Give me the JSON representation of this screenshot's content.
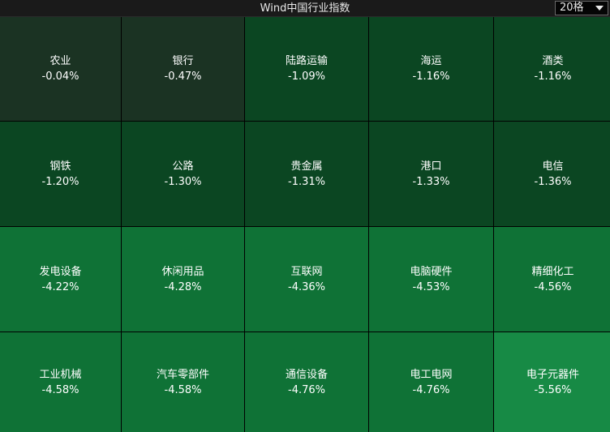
{
  "header": {
    "title": "Wind中国行业指数",
    "grid_select": "20格"
  },
  "tiles": [
    {
      "name": "农业",
      "change": "-0.04%",
      "color": "#1b3323"
    },
    {
      "name": "银行",
      "change": "-0.47%",
      "color": "#1b3323"
    },
    {
      "name": "陆路运输",
      "change": "-1.09%",
      "color": "#0b4622"
    },
    {
      "name": "海运",
      "change": "-1.16%",
      "color": "#0b4622"
    },
    {
      "name": "酒类",
      "change": "-1.16%",
      "color": "#0b4622"
    },
    {
      "name": "钢铁",
      "change": "-1.20%",
      "color": "#0b4622"
    },
    {
      "name": "公路",
      "change": "-1.30%",
      "color": "#0b4622"
    },
    {
      "name": "贵金属",
      "change": "-1.31%",
      "color": "#0b4622"
    },
    {
      "name": "港口",
      "change": "-1.33%",
      "color": "#0b4622"
    },
    {
      "name": "电信",
      "change": "-1.36%",
      "color": "#0b4622"
    },
    {
      "name": "发电设备",
      "change": "-4.22%",
      "color": "#0f7236"
    },
    {
      "name": "休闲用品",
      "change": "-4.28%",
      "color": "#0f7236"
    },
    {
      "name": "互联网",
      "change": "-4.36%",
      "color": "#0f7236"
    },
    {
      "name": "电脑硬件",
      "change": "-4.53%",
      "color": "#0f7236"
    },
    {
      "name": "精细化工",
      "change": "-4.56%",
      "color": "#0f7236"
    },
    {
      "name": "工业机械",
      "change": "-4.58%",
      "color": "#0f7236"
    },
    {
      "name": "汽车零部件",
      "change": "-4.58%",
      "color": "#0f7236"
    },
    {
      "name": "通信设备",
      "change": "-4.76%",
      "color": "#0f7236"
    },
    {
      "name": "电工电网",
      "change": "-4.76%",
      "color": "#0f7236"
    },
    {
      "name": "电子元器件",
      "change": "-5.56%",
      "color": "#178a45"
    }
  ]
}
